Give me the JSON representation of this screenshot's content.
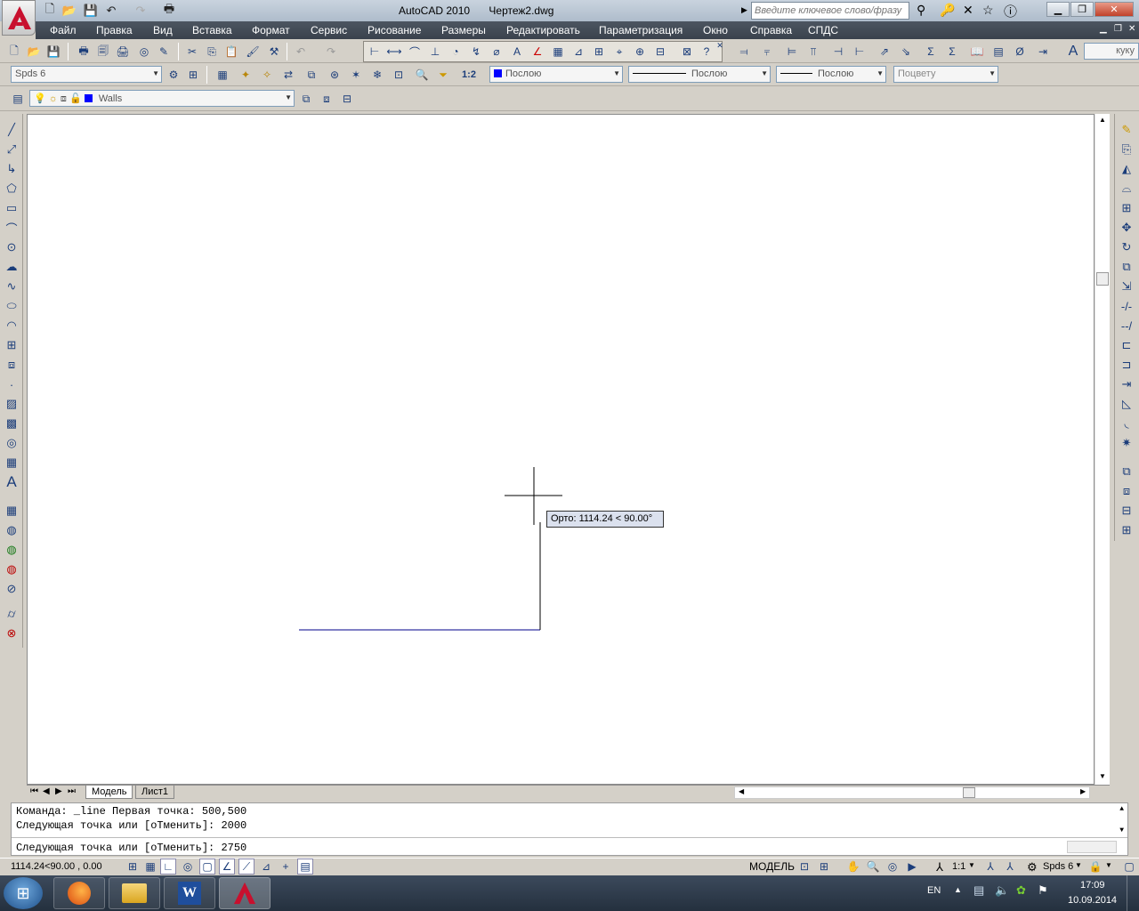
{
  "window": {
    "app_title": "AutoCAD 2010",
    "doc_title": "Чертеж2.dwg",
    "search_placeholder": "Введите ключевое слово/фразу"
  },
  "menu": [
    "Файл",
    "Правка",
    "Вид",
    "Вставка",
    "Формат",
    "Сервис",
    "Рисование",
    "Размеры",
    "Редактировать",
    "Параметризация",
    "Окно",
    "Справка",
    "СПДС"
  ],
  "toolbar2": {
    "style_right": "куку"
  },
  "properties": {
    "textstyle": "Spds 6",
    "scale_label": "1:2",
    "color": "Послою",
    "color_swatch": "#0000ff",
    "linetype": "Послою",
    "lineweight": "Послою",
    "plotstyle": "Поцвету"
  },
  "layer": {
    "name": "Walls",
    "swatch": "#0000ff"
  },
  "canvas": {
    "tooltip": "Орто: 1114.24 < 90.00°",
    "line_color": "#00008b",
    "rubber_color": "#000000"
  },
  "layout_tabs": [
    "Модель",
    "Лист1"
  ],
  "command": {
    "lines": [
      "Команда: _line Первая точка: 500,500",
      "Следующая точка или [оТменить]: 2000",
      "Следующая точка или [оТменить]: 2750"
    ]
  },
  "status": {
    "coords": "1114.24<90.00 , 0.00",
    "model": "МОДЕЛЬ",
    "annot_scale": "1:1",
    "workspace": "Spds 6"
  },
  "taskbar": {
    "lang": "EN",
    "time": "17:09",
    "date": "10.09.2014"
  },
  "icons": [
    "autocad-logo",
    "new-icon",
    "open-icon",
    "save-icon",
    "undo-icon",
    "redo-icon",
    "plot-icon",
    "search-icon",
    "help-icon",
    "line-icon",
    "polyline-icon",
    "circle-icon",
    "arc-icon",
    "rectangle-icon",
    "hatch-icon",
    "text-icon",
    "erase-icon",
    "copy-icon",
    "mirror-icon",
    "offset-icon",
    "move-icon",
    "rotate-icon",
    "scale-icon",
    "trim-icon",
    "extend-icon",
    "fillet-icon",
    "explode-icon"
  ]
}
